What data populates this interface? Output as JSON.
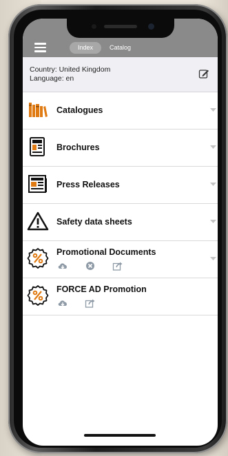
{
  "topbar": {
    "tabs": [
      {
        "label": "Index",
        "active": true
      },
      {
        "label": "Catalog",
        "active": false
      }
    ]
  },
  "info": {
    "country": "Country: United Kingdom",
    "language": "Language: en"
  },
  "items": [
    {
      "label": "Catalogues",
      "icon": "books-icon"
    },
    {
      "label": "Brochures",
      "icon": "brochure-icon"
    },
    {
      "label": "Press Releases",
      "icon": "newspaper-icon"
    },
    {
      "label": "Safety data sheets",
      "icon": "warning-triangle-icon"
    },
    {
      "label": "Promotional Documents",
      "icon": "percent-badge-icon",
      "actions": [
        "download-icon",
        "delete-icon",
        "share-icon"
      ]
    },
    {
      "label": "FORCE AD Promotion",
      "icon": "percent-badge-icon",
      "actions": [
        "download-icon",
        "share-icon"
      ]
    }
  ],
  "colors": {
    "accent": "#e07a12",
    "topbar": "#8a8a8a",
    "info_bg": "#efeff4"
  }
}
